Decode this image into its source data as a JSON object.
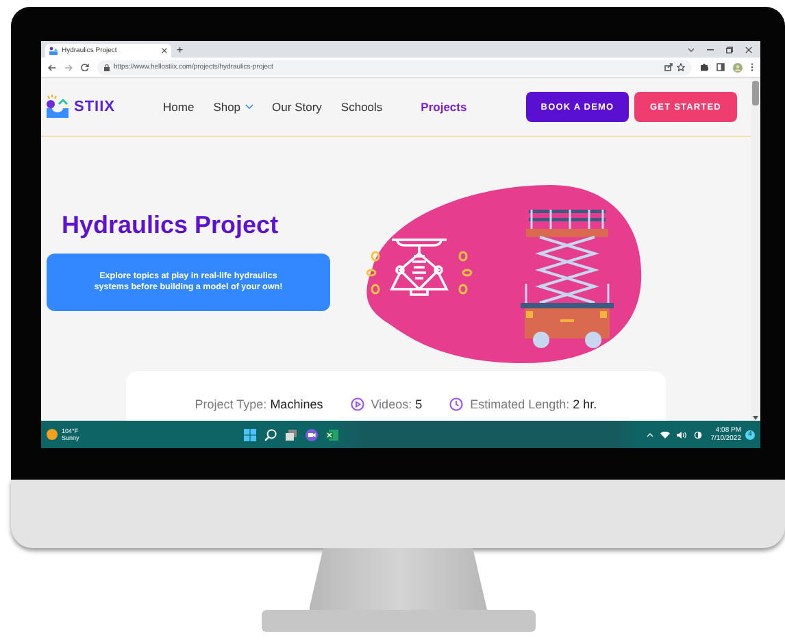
{
  "browser": {
    "tab_title": "Hydraulics Project",
    "new_tab": "+",
    "url": "https://www.hellostiix.com/projects/hydraulics-project"
  },
  "site": {
    "logo": "STIIX",
    "nav": [
      {
        "label": "Home",
        "kind": "link",
        "selected": false
      },
      {
        "label": "Shop",
        "kind": "dropdown",
        "selected": false
      },
      {
        "label": "Our Story",
        "kind": "link",
        "selected": false
      },
      {
        "label": "Schools",
        "kind": "link",
        "selected": false
      },
      {
        "label": "Projects",
        "kind": "link",
        "selected": true
      }
    ],
    "buttons": [
      {
        "label": "BOOK A DEMO",
        "kind": "primary"
      },
      {
        "label": "GET STARTED",
        "kind": "accent"
      }
    ],
    "hero": {
      "title": "Hydraulics Project",
      "description": "Explore topics at play in real-life hydraulics systems before building a model of your own!"
    },
    "info": [
      {
        "kind": "text",
        "label": "Project Type:",
        "value": "Machines"
      },
      {
        "kind": "video",
        "label": "Videos:",
        "value": "5"
      },
      {
        "kind": "clock",
        "label": "Estimated Length:",
        "value": "2 hr."
      }
    ]
  },
  "taskbar": {
    "temperature": "104°F",
    "condition": "Sunny",
    "time": "4:08 PM",
    "date": "7/10/2022",
    "notifications": "4"
  }
}
